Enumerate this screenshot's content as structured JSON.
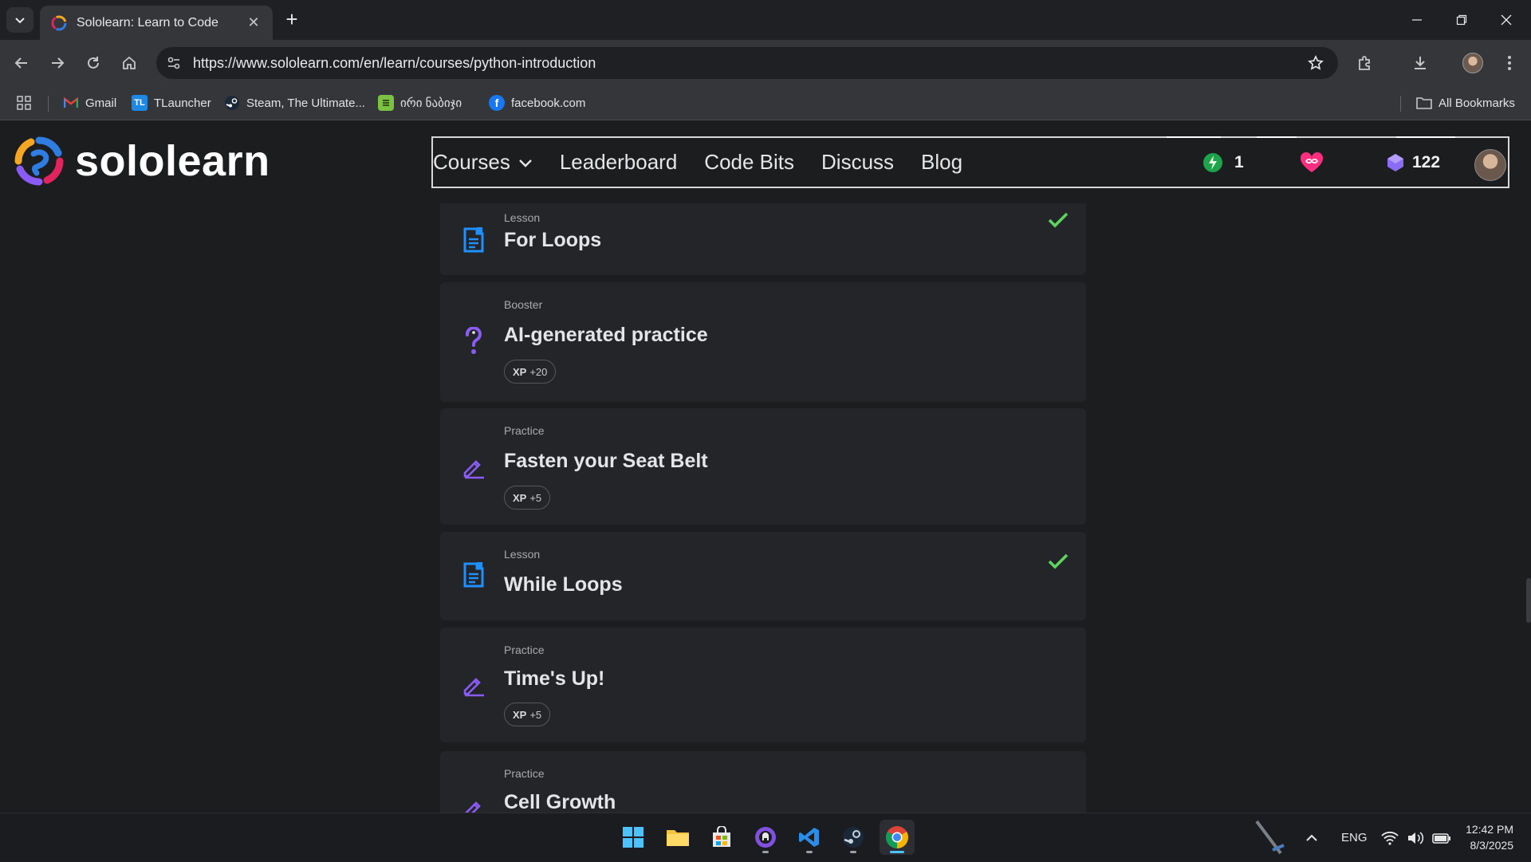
{
  "browser": {
    "tab_title": "Sololearn: Learn to Code",
    "url": "https://www.sololearn.com/en/learn/courses/python-introduction",
    "bookmarks": [
      {
        "label": "Gmail",
        "icon": "gmail-icon"
      },
      {
        "label": "TLauncher",
        "icon": "tlauncher-icon"
      },
      {
        "label": "Steam, The Ultimate...",
        "icon": "steam-icon"
      },
      {
        "label": "ირი ნაბიჯი",
        "icon": "bookmark-app-icon"
      },
      {
        "label": "facebook.com",
        "icon": "facebook-icon"
      }
    ],
    "all_bookmarks": "All Bookmarks"
  },
  "site": {
    "logo_text": "sololearn",
    "nav": {
      "courses": "Courses",
      "leaderboard": "Leaderboard",
      "code_bits": "Code Bits",
      "discuss": "Discuss",
      "blog": "Blog"
    },
    "streak": "1",
    "bits": "122"
  },
  "lessons": [
    {
      "kind": "Lesson",
      "title": "For Loops",
      "completed": true,
      "icon": "lesson-icon"
    },
    {
      "kind": "Booster",
      "title": "AI-generated practice",
      "xp_label": "XP",
      "xp_value": "+20",
      "icon": "question-mark-icon"
    },
    {
      "kind": "Practice",
      "title": "Fasten your Seat Belt",
      "xp_label": "XP",
      "xp_value": "+5",
      "icon": "pencil-icon"
    },
    {
      "kind": "Lesson",
      "title": "While Loops",
      "completed": true,
      "icon": "lesson-icon"
    },
    {
      "kind": "Practice",
      "title": "Time's Up!",
      "xp_label": "XP",
      "xp_value": "+5",
      "icon": "pencil-icon"
    },
    {
      "kind": "Practice",
      "title": "Cell Growth",
      "icon": "pencil-icon"
    }
  ],
  "taskbar": {
    "language": "ENG",
    "time": "12:42 PM",
    "date": "8/3/2025"
  },
  "colors": {
    "accent_blue": "#1e90ff",
    "check_green": "#5fd35f",
    "practice_purple": "#8a5cf5",
    "heart_pink": "#ff2e7e"
  }
}
